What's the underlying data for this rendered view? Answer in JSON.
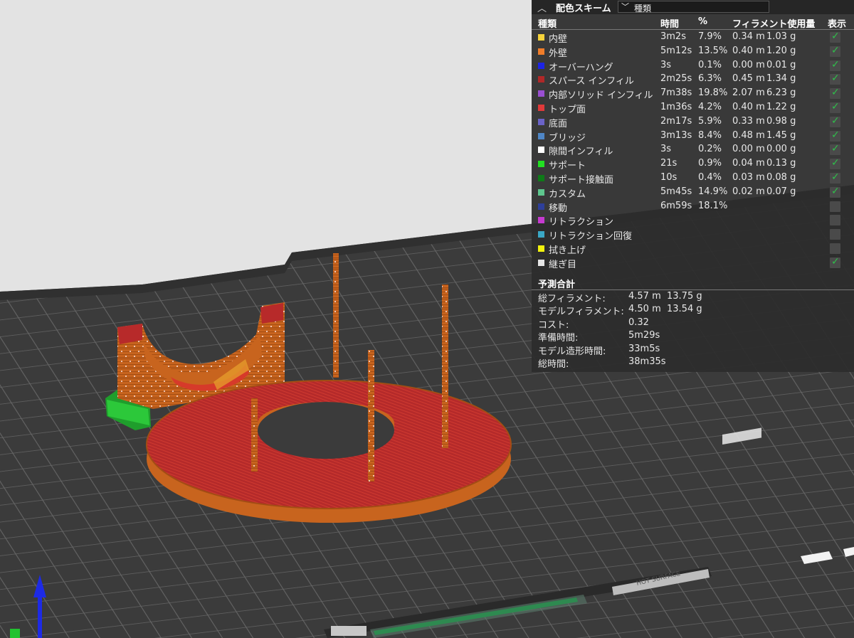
{
  "panel": {
    "title": "配色スキーム",
    "scheme_selected": "種類",
    "columns": {
      "type": "種類",
      "time": "時間",
      "percent": "%",
      "filament": "フィラメント使用量",
      "display": "表示"
    },
    "rows": [
      {
        "name": "内壁",
        "color": "#f5d23a",
        "time": "3m2s",
        "percent": "7.9%",
        "meters": "0.34 m",
        "grams": "1.03 g",
        "visible": true
      },
      {
        "name": "外壁",
        "color": "#f07d2a",
        "time": "5m12s",
        "percent": "13.5%",
        "meters": "0.40 m",
        "grams": "1.20 g",
        "visible": true
      },
      {
        "name": "オーバーハング",
        "color": "#1d24e6",
        "time": "3s",
        "percent": "0.1%",
        "meters": "0.00 m",
        "grams": "0.01 g",
        "visible": true
      },
      {
        "name": "スパース インフィル",
        "color": "#b02828",
        "time": "2m25s",
        "percent": "6.3%",
        "meters": "0.45 m",
        "grams": "1.34 g",
        "visible": true
      },
      {
        "name": "内部ソリッド インフィル",
        "color": "#9a4fd1",
        "time": "7m38s",
        "percent": "19.8%",
        "meters": "2.07 m",
        "grams": "6.23 g",
        "visible": true
      },
      {
        "name": "トップ面",
        "color": "#e03a3a",
        "time": "1m36s",
        "percent": "4.2%",
        "meters": "0.40 m",
        "grams": "1.22 g",
        "visible": true
      },
      {
        "name": "底面",
        "color": "#6b63c8",
        "time": "2m17s",
        "percent": "5.9%",
        "meters": "0.33 m",
        "grams": "0.98 g",
        "visible": true
      },
      {
        "name": "ブリッジ",
        "color": "#4f86c6",
        "time": "3m13s",
        "percent": "8.4%",
        "meters": "0.48 m",
        "grams": "1.45 g",
        "visible": true
      },
      {
        "name": "隙間インフィル",
        "color": "#ffffff",
        "time": "3s",
        "percent": "0.2%",
        "meters": "0.00 m",
        "grams": "0.00 g",
        "visible": true
      },
      {
        "name": "サポート",
        "color": "#22e022",
        "time": "21s",
        "percent": "0.9%",
        "meters": "0.04 m",
        "grams": "0.13 g",
        "visible": true
      },
      {
        "name": "サポート接触面",
        "color": "#0e7a18",
        "time": "10s",
        "percent": "0.4%",
        "meters": "0.03 m",
        "grams": "0.08 g",
        "visible": true
      },
      {
        "name": "カスタム",
        "color": "#5ec78e",
        "time": "5m45s",
        "percent": "14.9%",
        "meters": "0.02 m",
        "grams": "0.07 g",
        "visible": true
      },
      {
        "name": "移動",
        "color": "#2e3f9a",
        "time": "6m59s",
        "percent": "18.1%",
        "meters": "",
        "grams": "",
        "visible": false
      },
      {
        "name": "リトラクション",
        "color": "#c63ad0",
        "time": "",
        "percent": "",
        "meters": "",
        "grams": "",
        "visible": false
      },
      {
        "name": "リトラクション回復",
        "color": "#3aa8c6",
        "time": "",
        "percent": "",
        "meters": "",
        "grams": "",
        "visible": false
      },
      {
        "name": "拭き上げ",
        "color": "#f2f20e",
        "time": "",
        "percent": "",
        "meters": "",
        "grams": "",
        "visible": false
      },
      {
        "name": "継ぎ目",
        "color": "#e6e6e6",
        "time": "",
        "percent": "",
        "meters": "",
        "grams": "",
        "visible": true
      }
    ],
    "summary": {
      "title": "予測合計",
      "items": [
        {
          "label": "総フィラメント:",
          "v1": "4.57 m",
          "v2": "13.75 g"
        },
        {
          "label": "モデルフィラメント:",
          "v1": "4.50 m",
          "v2": "13.54 g"
        },
        {
          "label": "コスト:",
          "v1": "0.32",
          "v2": ""
        },
        {
          "label": "準備時間:",
          "v1": "5m29s",
          "v2": ""
        },
        {
          "label": "モデル造形時間:",
          "v1": "33m5s",
          "v2": ""
        },
        {
          "label": "総時間:",
          "v1": "38m35s",
          "v2": ""
        }
      ]
    }
  },
  "plate": {
    "hot_surface_label": "HOT SURFACE"
  },
  "icons": {
    "collapse": "chevron-up-icon",
    "dropdown": "chevron-down-icon",
    "checkbox": "checkmark-icon",
    "axis": "z-axis-arrow-icon"
  },
  "colors": {
    "background": "#e3e3e3",
    "plate": "#3a3a3a",
    "model_orange": "#c8641e",
    "model_red": "#b5282a",
    "support_green": "#22c230",
    "axis_blue": "#1d2ae6"
  }
}
